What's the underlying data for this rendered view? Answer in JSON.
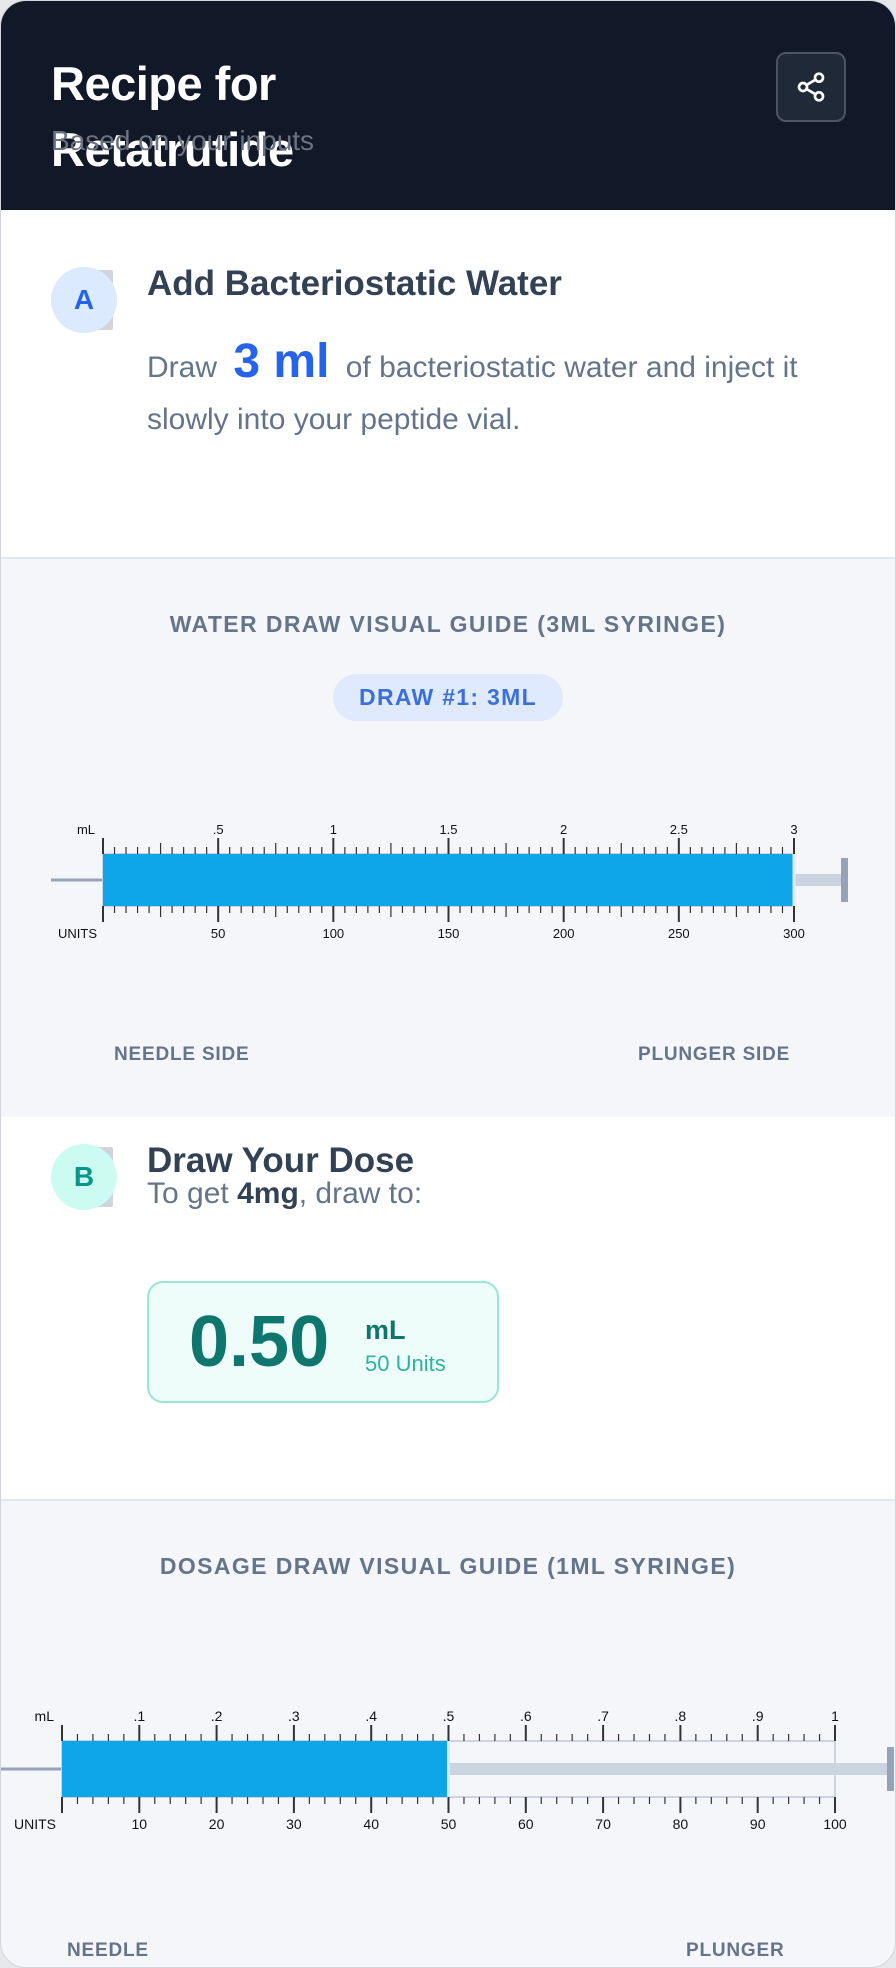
{
  "header": {
    "title": "Recipe for Retatrutide",
    "subtitle": "Based on your inputs",
    "share_icon": "share-icon"
  },
  "step_a": {
    "badge": "A",
    "title": "Add Bacteriostatic Water",
    "text_before": "Draw",
    "amount": "3 ml",
    "text_after": "of bacteriostatic water and inject it slowly into your peptide vial."
  },
  "water_guide": {
    "title": "WATER DRAW VISUAL GUIDE (3ML SYRINGE)",
    "pill": "DRAW #1: 3ML",
    "ml_label": "mL",
    "units_label": "UNITS",
    "ml_ticks": [
      ".5",
      "1",
      "1.5",
      "2",
      "2.5",
      "3"
    ],
    "unit_ticks": [
      "50",
      "100",
      "150",
      "200",
      "250",
      "300"
    ],
    "fill_fraction": 1.0,
    "needle_label": "NEEDLE SIDE",
    "plunger_label": "PLUNGER SIDE"
  },
  "step_b": {
    "badge": "B",
    "title": "Draw Your Dose",
    "text_before": "To get",
    "dose": "4mg",
    "text_after": ", draw to:",
    "value": "0.50",
    "unit": "mL",
    "units": "50 Units"
  },
  "dosage_guide": {
    "title": "DOSAGE DRAW VISUAL GUIDE (1ML SYRINGE)",
    "ml_label": "mL",
    "units_label": "UNITS",
    "ml_ticks": [
      ".1",
      ".2",
      ".3",
      ".4",
      ".5",
      ".6",
      ".7",
      ".8",
      ".9",
      "1"
    ],
    "unit_ticks": [
      "10",
      "20",
      "30",
      "40",
      "50",
      "60",
      "70",
      "80",
      "90",
      "100"
    ],
    "fill_fraction": 0.5,
    "needle_label": "NEEDLE",
    "plunger_label": "PLUNGER"
  },
  "colors": {
    "header_bg": "#111827",
    "accent_blue": "#2563eb",
    "fill": "#0ea5e9",
    "teal": "#0f766e",
    "guide_bg": "#f4f6f9"
  }
}
